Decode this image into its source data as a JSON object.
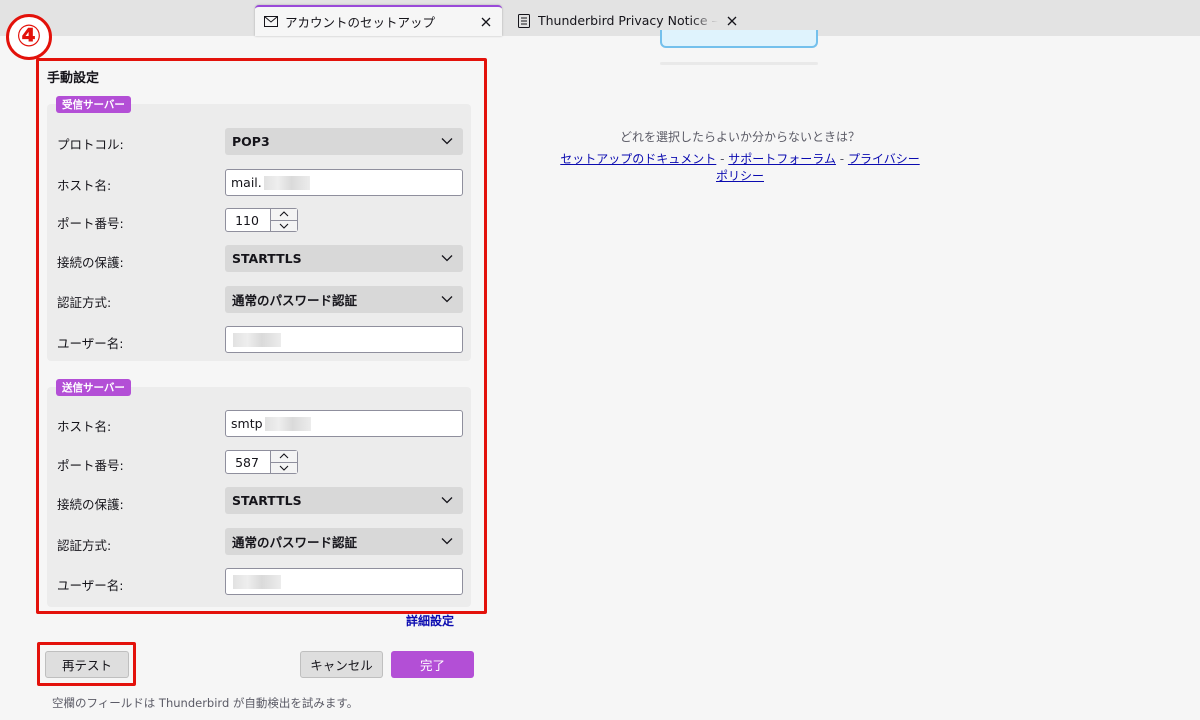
{
  "tabs": [
    {
      "title": "アカウントのセットアップ",
      "icon": "mail-icon",
      "active": true
    },
    {
      "title": "Thunderbird Privacy Notice — Mozilla",
      "icon": "document-icon",
      "active": false
    }
  ],
  "annotation": {
    "step": "④",
    "color": "#e3120b"
  },
  "help": {
    "question": "どれを選択したらよいか分からないときは？",
    "links": [
      "セットアップのドキュメント",
      "サポートフォーラム",
      "プライバシーポリシー"
    ],
    "separator": "-"
  },
  "manual": {
    "title": "手動設定",
    "incoming": {
      "legend": "受信サーバー",
      "protocol_label": "プロトコル:",
      "protocol": "POP3",
      "host_label": "ホスト名:",
      "host": "mail.",
      "port_label": "ポート番号:",
      "port": "110",
      "security_label": "接続の保護:",
      "security": "STARTTLS",
      "auth_label": "認証方式:",
      "auth": "通常のパスワード認証",
      "username_label": "ユーザー名:",
      "username": ""
    },
    "outgoing": {
      "legend": "送信サーバー",
      "host_label": "ホスト名:",
      "host": "smtp",
      "port_label": "ポート番号:",
      "port": "587",
      "security_label": "接続の保護:",
      "security": "STARTTLS",
      "auth_label": "認証方式:",
      "auth": "通常のパスワード認証",
      "username_label": "ユーザー名:",
      "username": ""
    },
    "advanced_link": "詳細設定"
  },
  "buttons": {
    "retest": "再テスト",
    "cancel": "キャンセル",
    "done": "完了"
  },
  "footer_note": "空欄のフィールドは Thunderbird が自動検出を試みます。",
  "colors": {
    "accent": "#b34fd6",
    "annotation": "#e3120b",
    "link": "#0b0bb0"
  }
}
